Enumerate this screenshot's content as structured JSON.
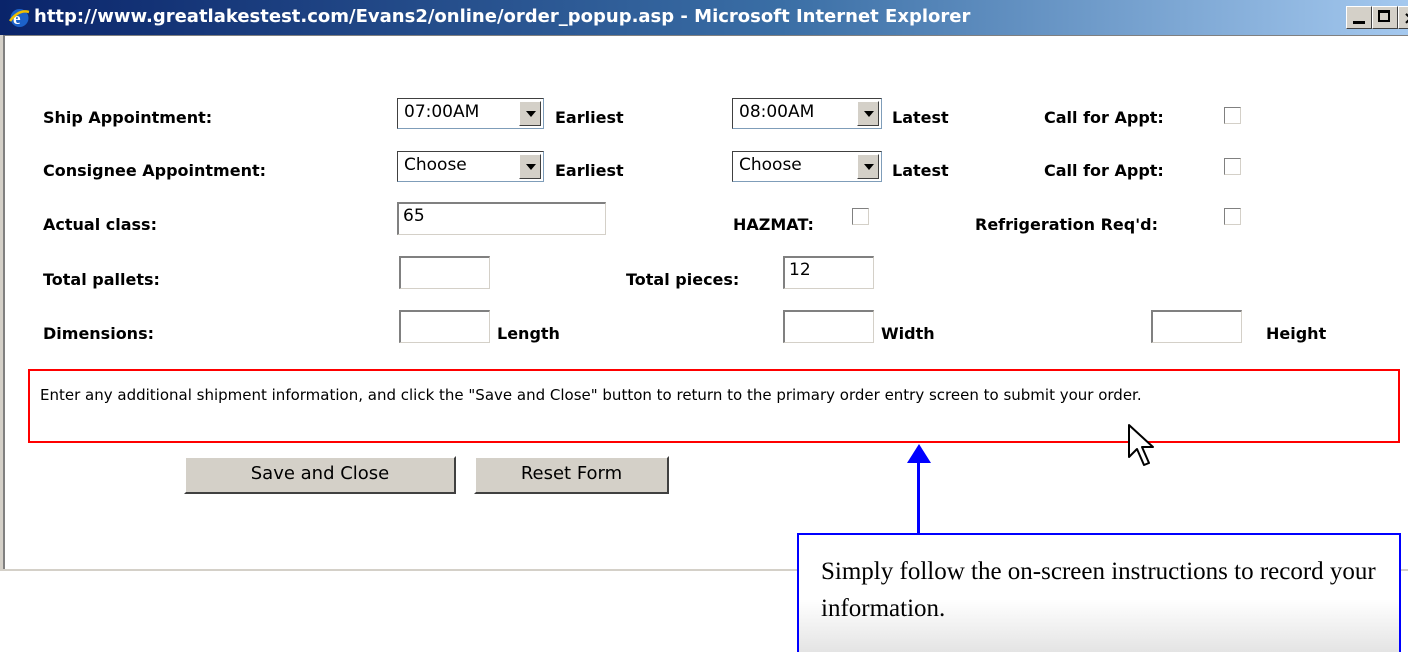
{
  "window": {
    "title": "http://www.greatlakestest.com/Evans2/online/order_popup.asp - Microsoft Internet Explorer",
    "controls": [
      "minimize-icon",
      "maximize-icon",
      "close-icon"
    ]
  },
  "form": {
    "ship_appt": {
      "label": "Ship Appointment:",
      "earliest_value": "07:00AM",
      "earliest_label": "Earliest",
      "latest_value": "08:00AM",
      "latest_label": "Latest",
      "call_label": "Call for Appt:"
    },
    "consignee_appt": {
      "label": "Consignee Appointment:",
      "earliest_value": "Choose",
      "earliest_label": "Earliest",
      "latest_value": "Choose",
      "latest_label": "Latest",
      "call_label": "Call for Appt:"
    },
    "actual_class": {
      "label": "Actual class:",
      "value": "65"
    },
    "hazmat_label": "HAZMAT:",
    "refrigeration_label": "Refrigeration Req'd:",
    "total_pallets": {
      "label": "Total pallets:",
      "value": ""
    },
    "total_pieces": {
      "label": "Total pieces:",
      "value": "12"
    },
    "dimensions": {
      "label": "Dimensions:",
      "length_label": "Length",
      "width_label": "Width",
      "height_label": "Height"
    },
    "instructions": "Enter any additional shipment information, and click the \"Save and Close\" button to return to the primary order entry screen to submit your order.",
    "save_label": "Save and Close",
    "reset_label": "Reset Form"
  },
  "callout": {
    "text": "Simply follow the on-screen instructions to record your information."
  },
  "colors": {
    "title_bar": "#0a246a",
    "highlight_box": "#ff0000",
    "callout_border": "#0000ff"
  }
}
